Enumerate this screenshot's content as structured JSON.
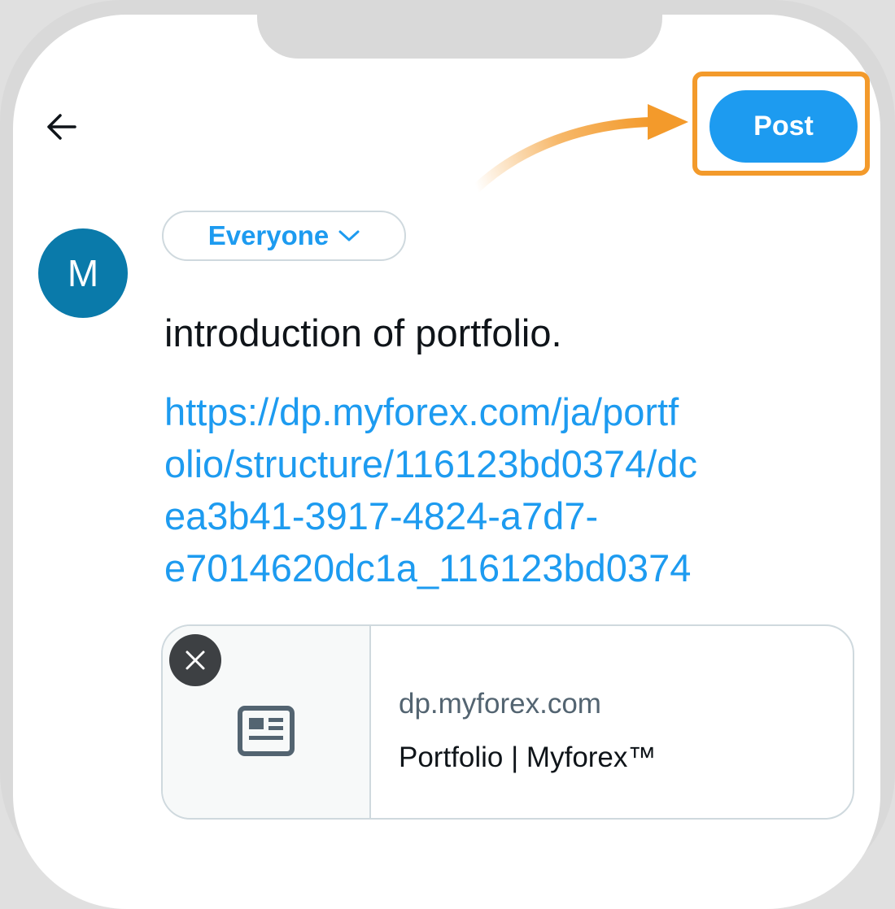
{
  "header": {
    "back_icon": "arrow-left-icon",
    "post_label": "Post"
  },
  "composer": {
    "avatar_letter": "M",
    "audience_label": "Everyone",
    "audience_icon": "chevron-down-icon",
    "text": "introduction of portfolio.",
    "link_lines": [
      "https://dp.myforex.com/ja/portf",
      "olio/structure/116123bd0374/dc",
      "ea3b41-3917-4824-a7d7-",
      "e7014620dc1a_116123bd0374"
    ]
  },
  "link_card": {
    "close_icon": "close-icon",
    "thumb_icon": "article-icon",
    "domain": "dp.myforex.com",
    "title": "Portfolio | Myforex™"
  },
  "colors": {
    "accent": "#1d9bf0",
    "highlight": "#f39a2b",
    "avatar": "#0a7aaa"
  }
}
